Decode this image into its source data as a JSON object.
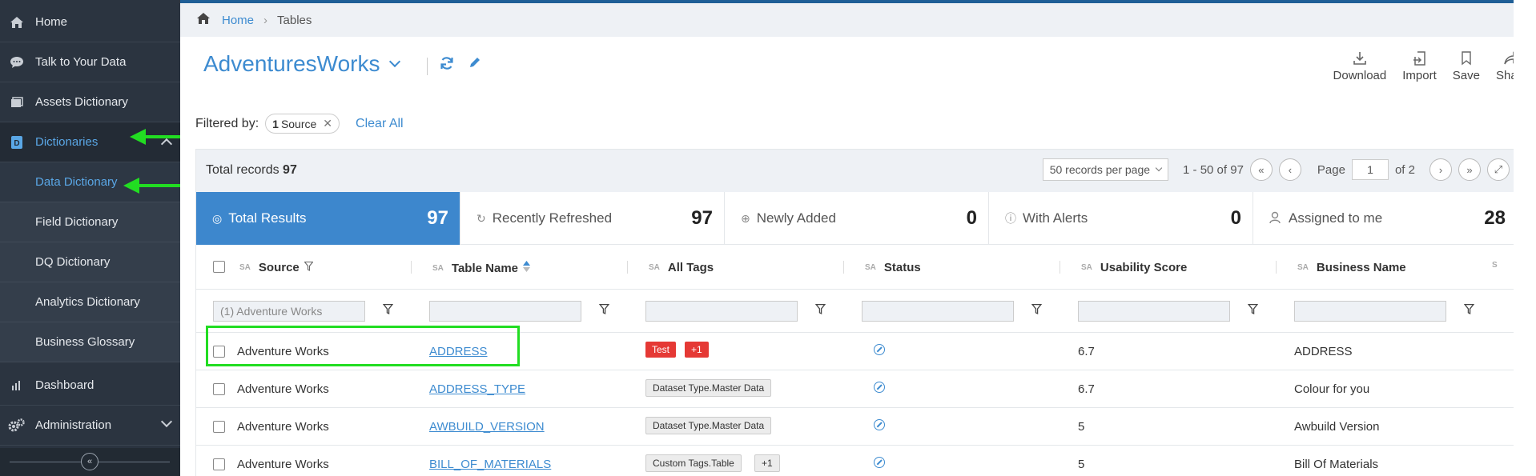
{
  "sidebar": {
    "items": [
      {
        "label": "Home",
        "icon": "home-icon"
      },
      {
        "label": "Talk to Your Data",
        "icon": "chat-icon"
      },
      {
        "label": "Assets Dictionary",
        "icon": "assets-icon"
      },
      {
        "label": "Dictionaries",
        "icon": "dictionary-icon"
      },
      {
        "label": "Dashboard",
        "icon": "chart-icon"
      },
      {
        "label": "Administration",
        "icon": "gears-icon"
      }
    ],
    "subitems": [
      {
        "label": "Data Dictionary"
      },
      {
        "label": "Field Dictionary"
      },
      {
        "label": "DQ Dictionary"
      },
      {
        "label": "Analytics Dictionary"
      },
      {
        "label": "Business Glossary"
      }
    ],
    "collapse_glyph": "«"
  },
  "breadcrumb": {
    "home": "Home",
    "current": "Tables"
  },
  "header": {
    "title": "AdventuresWorks",
    "actions": [
      {
        "label": "Download",
        "icon": "download-icon"
      },
      {
        "label": "Import",
        "icon": "import-icon"
      },
      {
        "label": "Save",
        "icon": "bookmark-icon"
      },
      {
        "label": "Share",
        "icon": "share-icon"
      }
    ]
  },
  "filter": {
    "label": "Filtered by:",
    "chip_count": "1",
    "chip_label": "Source",
    "clear": "Clear All"
  },
  "totals": {
    "prefix": "Total records",
    "count": "97"
  },
  "pager": {
    "per_page": "50 records per page",
    "range": "1 - 50 of 97",
    "page_label": "Page",
    "page": "1",
    "of": "of 2"
  },
  "cards": [
    {
      "label": "Total Results",
      "value": "97"
    },
    {
      "label": "Recently Refreshed",
      "value": "97"
    },
    {
      "label": "Newly Added",
      "value": "0"
    },
    {
      "label": "With Alerts",
      "value": "0"
    },
    {
      "label": "Assigned to me",
      "value": "28"
    }
  ],
  "columns": [
    {
      "sa": "SA",
      "label": "Source"
    },
    {
      "sa": "SA",
      "label": "Table Name"
    },
    {
      "sa": "SA",
      "label": "All Tags"
    },
    {
      "sa": "SA",
      "label": "Status"
    },
    {
      "sa": "SA",
      "label": "Usability Score"
    },
    {
      "sa": "SA",
      "label": "Business Name"
    },
    {
      "sa": "S",
      "label": ""
    }
  ],
  "filters": {
    "source_placeholder": "(1) Adventure Works"
  },
  "rows": [
    {
      "source": "Adventure Works",
      "table": "ADDRESS",
      "tag1": "Test",
      "tag2": "+1",
      "score": "6.7",
      "business": "ADDRESS"
    },
    {
      "source": "Adventure Works",
      "table": "ADDRESS_TYPE",
      "tag1": "Dataset Type.Master Data",
      "tag2": "",
      "score": "6.7",
      "business": "Colour for you"
    },
    {
      "source": "Adventure Works",
      "table": "AWBUILD_VERSION",
      "tag1": "Dataset Type.Master Data",
      "tag2": "",
      "score": "5",
      "business": "Awbuild Version"
    },
    {
      "source": "Adventure Works",
      "table": "BILL_OF_MATERIALS",
      "tag1": "Custom Tags.Table",
      "tag2": "+1",
      "score": "5",
      "business": "Bill Of Materials"
    }
  ],
  "colors": {
    "accent": "#3d87cd",
    "sidebar": "#2b3440",
    "highlight": "#22dd22",
    "tag_red": "#e53935"
  }
}
